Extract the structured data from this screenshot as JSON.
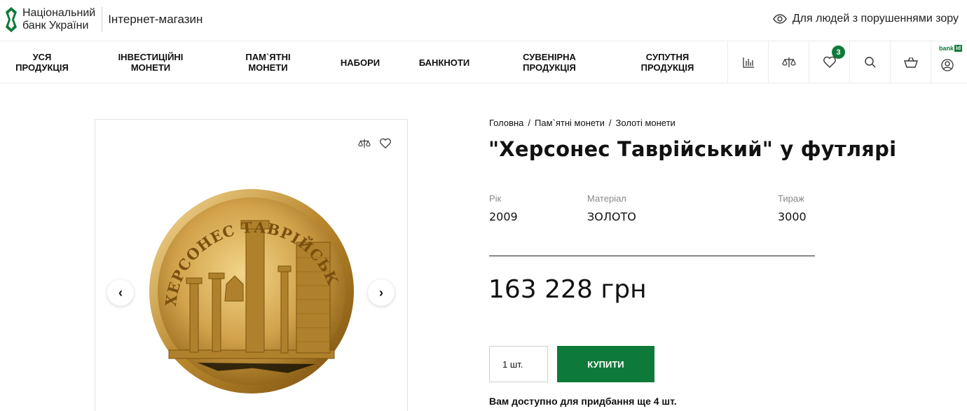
{
  "header": {
    "logo_line1": "Національний",
    "logo_line2": "банк України",
    "shop_label": "Інтернет-магазин",
    "accessibility": "Для людей з порушеннями зору"
  },
  "nav": {
    "items": [
      {
        "l1": "УСЯ",
        "l2": "ПРОДУКЦІЯ"
      },
      {
        "l1": "ІНВЕСТИЦІЙНІ",
        "l2": "МОНЕТИ"
      },
      {
        "l1": "ПАМ`ЯТНІ",
        "l2": "МОНЕТИ"
      },
      {
        "l1": "НАБОРИ",
        "l2": ""
      },
      {
        "l1": "БАНКНОТИ",
        "l2": ""
      },
      {
        "l1": "СУВЕНІРНА",
        "l2": "ПРОДУКЦІЯ"
      },
      {
        "l1": "СУПУТНЯ",
        "l2": "ПРОДУКЦІЯ"
      }
    ],
    "icons": [
      "chart-icon",
      "compare-icon",
      "heart-icon",
      "search-icon",
      "cart-icon",
      "user-icon"
    ],
    "favorites_count": "3",
    "bankid_text": "bank",
    "bankid_id": "id"
  },
  "gallery": {
    "coin_legend": "ХЕРСОНЕС ТАВРІЙСЬКИЙ",
    "prev": "‹",
    "next": "›"
  },
  "product": {
    "breadcrumb": [
      "Головна",
      "Пам`ятні монети",
      "Золоті монети"
    ],
    "breadcrumb_sep": "/",
    "title": "\"Херсонес Таврійський\" у футлярі",
    "attributes": [
      {
        "label": "Рік",
        "value": "2009"
      },
      {
        "label": "Матеріал",
        "value": "ЗОЛОТО"
      },
      {
        "label": "Тираж",
        "value": "3000"
      }
    ],
    "price": "163 228 грн",
    "quantity": "1 шт.",
    "buy_label": "КУПИТИ",
    "availability": "Вам доступно для придбання ще 4 шт."
  },
  "colors": {
    "brand_green": "#0e7a3a",
    "coin_gold": "#c9962a"
  }
}
